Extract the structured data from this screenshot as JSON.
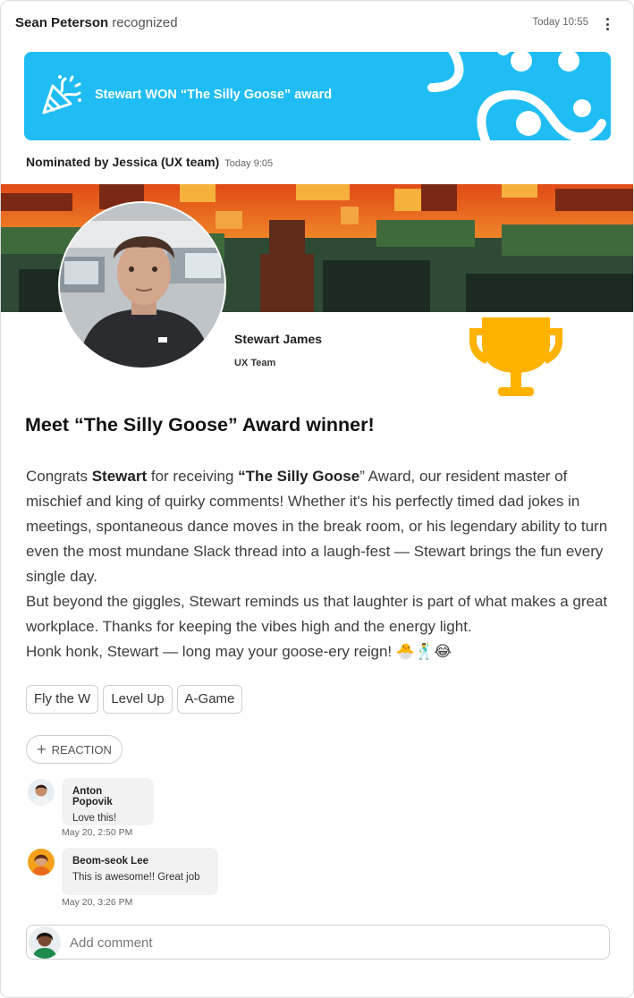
{
  "header": {
    "author": "Sean Peterson",
    "verb": "recognized",
    "time": "Today 10:55",
    "menu_icon": "more-vertical-icon"
  },
  "banner": {
    "icon": "party-popper-icon",
    "text": "Stewart WON “The Silly Goose” award",
    "background": "#1fbdf4"
  },
  "nomination": {
    "by": "Nominated by Jessica (UX team)",
    "time": "Today 9:05"
  },
  "recipient": {
    "name": "Stewart James",
    "team": "UX Team",
    "trophy_icon": "trophy-icon",
    "trophy_color": "#ffb200"
  },
  "post": {
    "title": "Meet “The Silly Goose” Award winner!",
    "p1_pre": "Congrats ",
    "p1_name": "Stewart",
    "p1_mid": " for receiving ",
    "p1_award_quoted": "“The Silly Goose",
    "p1_award_rest": "” Award",
    "p1_post": ", our resident master of mischief and king of quirky comments! Whether it's his perfectly timed dad jokes in meetings, spontaneous dance moves in the break room, or his legendary ability to turn even the most mundane Slack thread into a laugh-fest — Stewart brings the fun every single day.",
    "p2": "But beyond the giggles, Stewart reminds us that laughter is part of what makes a great workplace. Thanks for keeping the vibes high and the energy light.",
    "p3": "Honk honk, Stewart — long may your goose-ery reign! 🐣🕺😂"
  },
  "tags": [
    "Fly the W",
    "Level Up",
    "A-Game"
  ],
  "reaction_button": "REACTION",
  "comments": [
    {
      "name": "Anton Popovik",
      "text": "Love this!",
      "date": "May 20, 2:50 PM"
    },
    {
      "name": "Beom-seok Lee",
      "text": "This is awesome!! Great job",
      "date": "May 20, 3:26 PM"
    }
  ],
  "add_comment": {
    "placeholder": "Add comment"
  }
}
